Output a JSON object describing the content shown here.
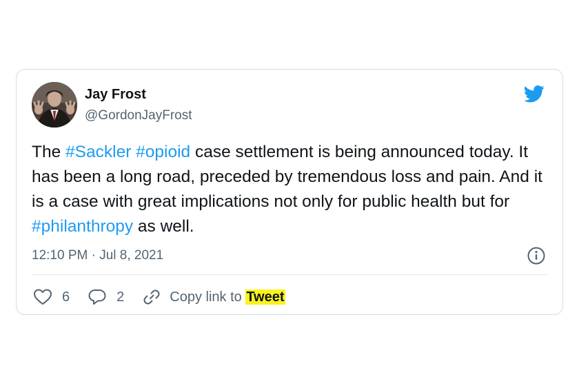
{
  "tweet": {
    "author_name": "Jay Frost",
    "author_handle": "@GordonJayFrost",
    "text_segments": [
      {
        "text": "The ",
        "hashtag": false
      },
      {
        "text": "#Sackler",
        "hashtag": true
      },
      {
        "text": " ",
        "hashtag": false
      },
      {
        "text": "#opioid",
        "hashtag": true
      },
      {
        "text": " case settlement is being announced today. It has been a long road, preceded by tremendous loss and pain. And it is a case with great implications not only for public health but for ",
        "hashtag": false
      },
      {
        "text": "#philanthropy",
        "hashtag": true
      },
      {
        "text": " as well.",
        "hashtag": false
      }
    ],
    "timestamp": "12:10 PM · Jul 8, 2021",
    "like_count": "6",
    "reply_count": "2",
    "copy_link_prefix": "Copy link to ",
    "copy_link_highlight": "Tweet"
  },
  "icons": {
    "brand": "twitter-bird-icon",
    "info": "info-icon",
    "like": "heart-icon",
    "reply": "speech-bubble-icon",
    "copy_link": "link-icon"
  },
  "colors": {
    "accent": "#1d9bf0",
    "text": "#0f1419",
    "secondary": "#536471",
    "border": "#d3dbe1",
    "highlight": "#fbf31b"
  }
}
